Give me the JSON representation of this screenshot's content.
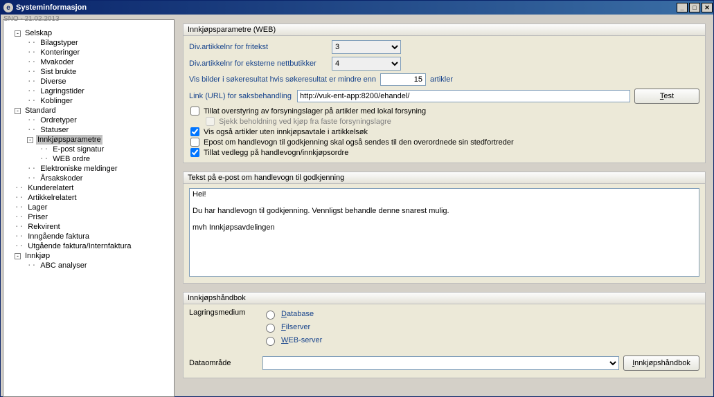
{
  "window": {
    "title": "Systeminformasjon",
    "breadcrumb": "SNO - 21.02.2013"
  },
  "tree": [
    {
      "label": "Selskap",
      "level": 0,
      "expand": "-",
      "children": [
        {
          "label": "Bilagstyper",
          "level": 1
        },
        {
          "label": "Konteringer",
          "level": 1
        },
        {
          "label": "Mvakoder",
          "level": 1
        },
        {
          "label": "Sist brukte",
          "level": 1
        },
        {
          "label": "Diverse",
          "level": 1
        },
        {
          "label": "Lagringstider",
          "level": 1
        },
        {
          "label": "Koblinger",
          "level": 1
        }
      ]
    },
    {
      "label": "Standard",
      "level": 0,
      "expand": "-",
      "children": [
        {
          "label": "Ordretyper",
          "level": 1
        },
        {
          "label": "Statuser",
          "level": 1
        },
        {
          "label": "Innkjøpsparametre",
          "level": 1,
          "expand": "-",
          "selected": true,
          "children": [
            {
              "label": "E-post signatur",
              "level": 2
            },
            {
              "label": "WEB ordre",
              "level": 2
            }
          ]
        },
        {
          "label": "Elektroniske meldinger",
          "level": 1
        },
        {
          "label": "Årsakskoder",
          "level": 1
        }
      ]
    },
    {
      "label": "Kunderelatert",
      "level": 0
    },
    {
      "label": "Artikkelrelatert",
      "level": 0
    },
    {
      "label": "Lager",
      "level": 0
    },
    {
      "label": "Priser",
      "level": 0
    },
    {
      "label": "Rekvirent",
      "level": 0
    },
    {
      "label": "Inngående faktura",
      "level": 0
    },
    {
      "label": "Utgående faktura/Internfaktura",
      "level": 0
    },
    {
      "label": "Innkjøp",
      "level": 0,
      "expand": "-",
      "children": [
        {
          "label": "ABC analyser",
          "level": 1
        }
      ]
    }
  ],
  "group1": {
    "title": "Innkjøpsparametre (WEB)",
    "label_fritekst": "Div.artikkelnr for fritekst",
    "value_fritekst": "3",
    "label_eksterne": "Div.artikkelnr for eksterne nettbutikker",
    "value_eksterne": "4",
    "label_bilder_pre": "Vis bilder i søkeresultat hvis søkeresultat er mindre enn",
    "value_bilder": "15",
    "label_bilder_post": "artikler",
    "label_url": "Link (URL) for saksbehandling",
    "value_url": "http://vuk-ent-app:8200/ehandel/",
    "btn_test": "Test",
    "chk_overstyring": "Tillat overstyring av forsyningslager på artikler med lokal forsyning",
    "chk_overstyring_v": false,
    "chk_sjekk": "Sjekk beholdning ved kjøp fra faste forsyningslagre",
    "chk_sjekk_v": false,
    "chk_visogsa": "Vis også artikler uten innkjøpsavtale i artikkelsøk",
    "chk_visogsa_v": true,
    "chk_epost": "Epost om handlevogn til godkjenning skal også sendes til den overordnede sin stedfortreder",
    "chk_epost_v": false,
    "chk_vedlegg": "Tillat vedlegg på handlevogn/innkjøpsordre",
    "chk_vedlegg_v": true
  },
  "group2": {
    "title": "Tekst på e-post om handlevogn til godkjenning",
    "text": "Hei!\n\nDu har handlevogn til godkjenning. Vennligst behandle denne snarest mulig.\n\nmvh Innkjøpsavdelingen"
  },
  "group3": {
    "title": "Innkjøpshåndbok",
    "label_medium": "Lagringsmedium",
    "radios": [
      "Database",
      "Filserver",
      "WEB-server"
    ],
    "label_dataomrade": "Dataområde",
    "value_dataomrade": "",
    "btn_handbok": "Innkjøpshåndbok"
  }
}
